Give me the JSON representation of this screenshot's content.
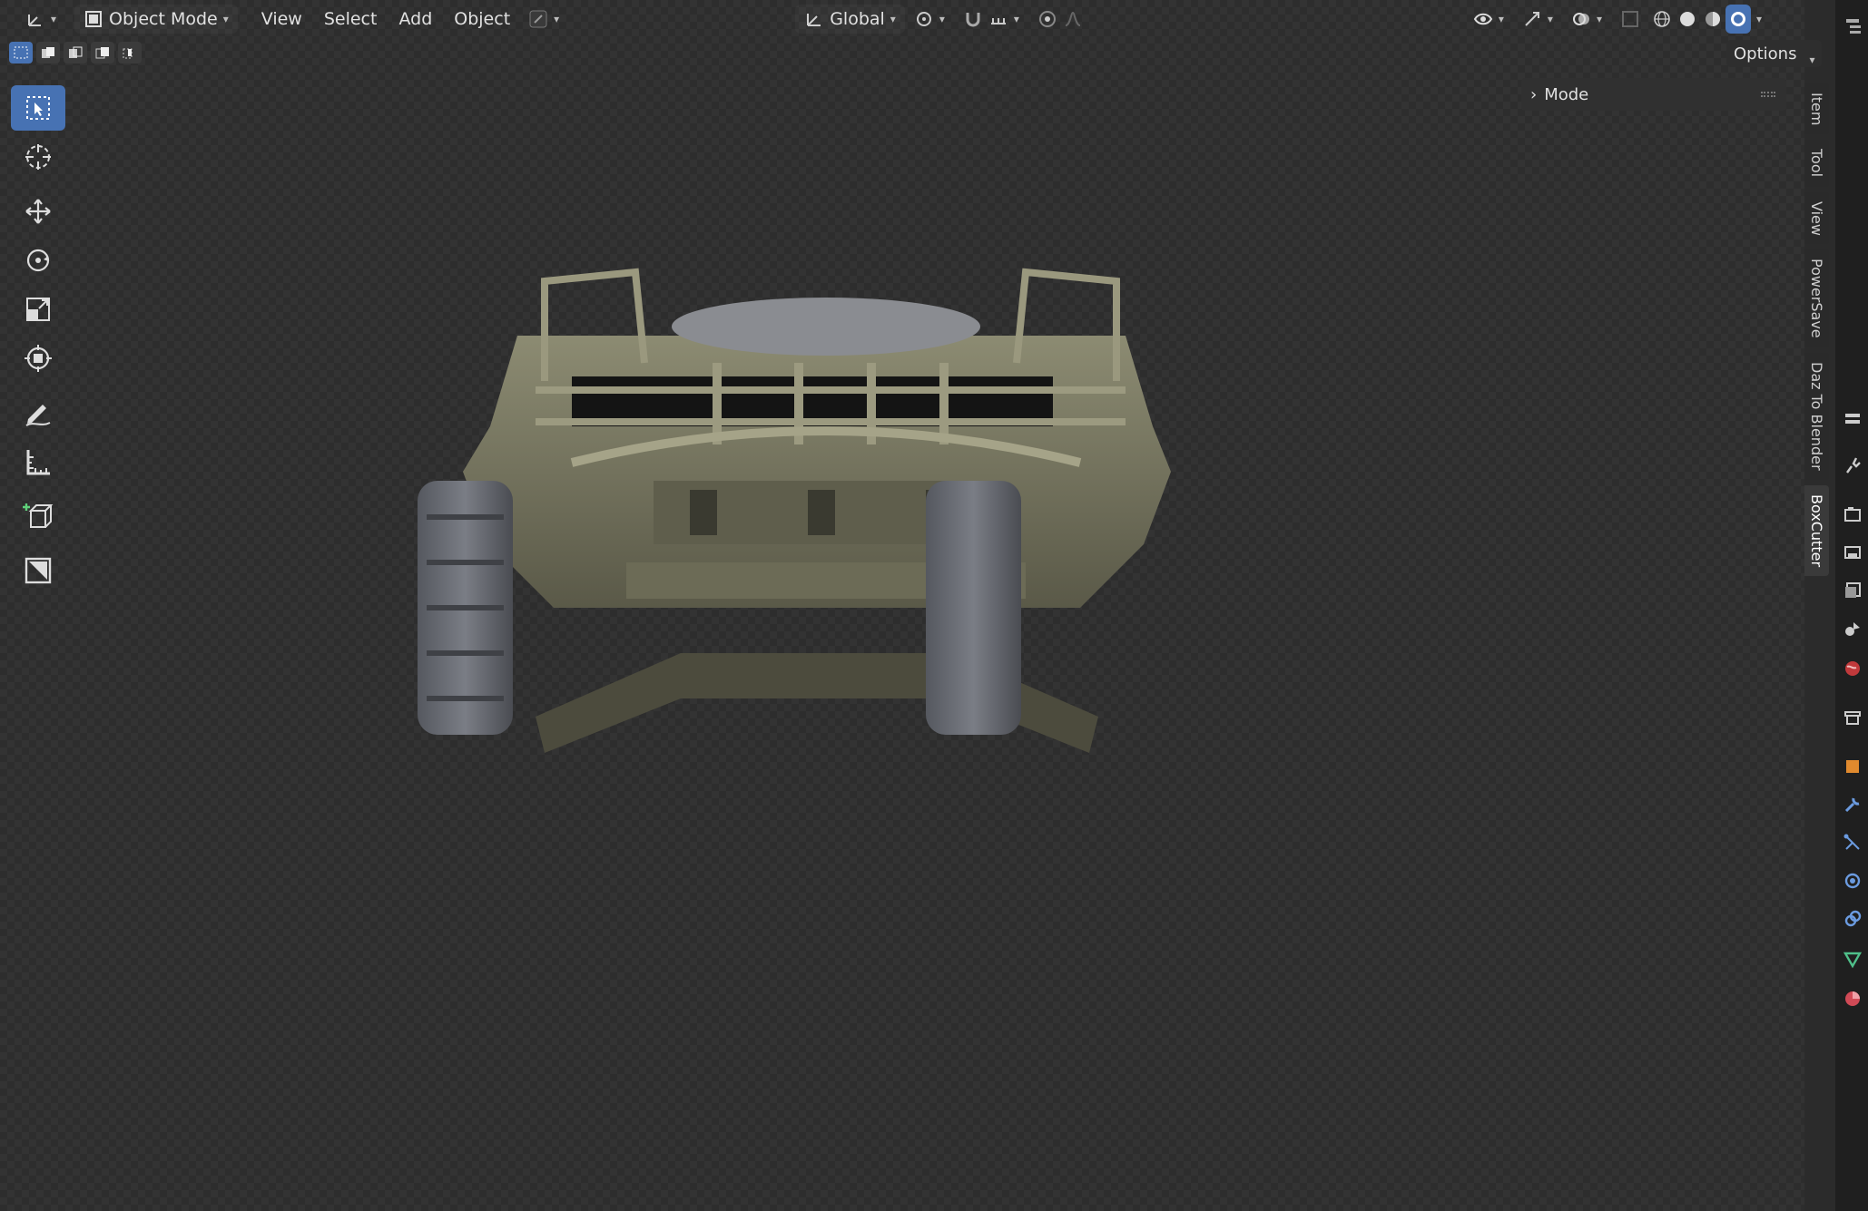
{
  "header": {
    "mode_label": "Object Mode",
    "menu": [
      "View",
      "Select",
      "Add",
      "Object"
    ],
    "transform_orientation": "Global",
    "options_label": "Options"
  },
  "panel": {
    "mode_label": "Mode"
  },
  "ntabs": [
    "Item",
    "Tool",
    "View",
    "PowerSave",
    "Daz To Blender",
    "BoxCutter"
  ],
  "active_ntab": "BoxCutter",
  "colors": {
    "accent": "#4772b3",
    "viewport_bg": "#2d2d2d",
    "model_body": "#7b7b62",
    "model_tires": "#6a6d75"
  },
  "icons": {
    "editor_type": "axes-icon",
    "select_box": "select-box-icon",
    "cursor": "cursor-icon",
    "move": "move-icon",
    "rotate": "rotate-icon",
    "scale": "scale-icon",
    "transform": "transform-icon",
    "annotate": "annotate-icon",
    "measure": "measure-icon",
    "add_cube": "add-cube-icon",
    "boxcutter": "boxcutter-icon"
  }
}
